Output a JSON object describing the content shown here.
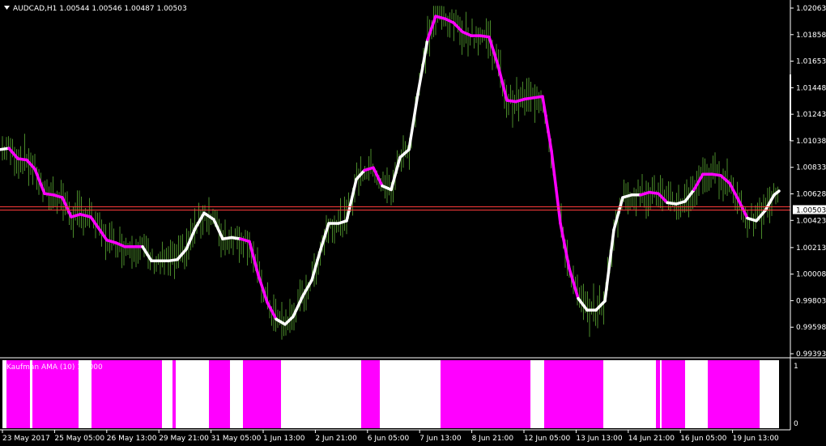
{
  "header": {
    "symbol_line": "AUDCAD,H1  1.00544 1.00546 1.00487 1.00503",
    "menu_arrow_icon": "triangle-down-icon"
  },
  "colors": {
    "background": "#000000",
    "candles": "#4a8a2a",
    "ama_up": "#ffffff",
    "ama_down": "#ff00ff",
    "price_line": "#ff3b3b",
    "price_label_bg": "#ffffff",
    "price_label_text": "#000000",
    "subwindow_bg": "#ffffff",
    "signal_fill": "#ff00ff",
    "axis": "#ffffff"
  },
  "price_axis": {
    "ticks": [
      "1.02063",
      "1.01858",
      "1.01653",
      "1.01448",
      "1.01243",
      "1.01038",
      "1.00833",
      "1.00628",
      "1.00423",
      "1.00213",
      "1.00008",
      "0.99803",
      "0.99598",
      "0.99393"
    ],
    "current_price": "1.00503"
  },
  "time_axis": {
    "labels": [
      "23 May 2017",
      "25 May 05:00",
      "26 May 13:00",
      "29 May 21:00",
      "31 May 05:00",
      "1 Jun 13:00",
      "2 Jun 21:00",
      "6 Jun 05:00",
      "7 Jun 13:00",
      "8 Jun 21:00",
      "12 Jun 05:00",
      "13 Jun 13:00",
      "14 Jun 21:00",
      "16 Jun 05:00",
      "19 Jun 13:00"
    ]
  },
  "indicator": {
    "label": "Kaufman AMA (10) 1.0000",
    "scale_top": "1",
    "scale_bottom": "0"
  },
  "chart_data": {
    "type": "line",
    "title": "AUDCAD,H1",
    "series": [
      {
        "name": "Kaufman AMA (10)",
        "x": [
          0,
          11,
          22,
          33,
          43,
          55,
          66,
          77,
          88,
          99,
          112,
          132,
          143,
          154,
          165,
          176,
          187,
          198,
          208,
          219,
          230,
          241,
          252,
          264,
          275,
          286,
          297,
          308,
          319,
          330,
          341,
          352,
          362,
          374,
          385,
          396,
          406,
          418,
          428,
          440,
          450,
          461,
          472,
          483,
          494,
          505,
          516,
          528,
          538,
          550,
          560,
          571,
          582,
          593,
          604,
          615,
          626,
          637,
          648,
          659,
          670,
          681,
          692,
          703,
          714,
          725,
          736,
          747,
          758,
          769,
          780,
          791,
          802,
          813,
          824,
          835,
          846,
          857,
          868,
          879,
          890,
          901,
          912,
          923,
          934,
          945,
          956,
          962
        ],
        "y": [
          1.0097,
          1.0098,
          1.009,
          1.0089,
          1.0082,
          1.0063,
          1.0062,
          1.006,
          1.0045,
          1.0047,
          1.0045,
          1.0027,
          1.0025,
          1.0022,
          1.0022,
          1.0022,
          1.0011,
          1.0011,
          1.0011,
          1.0012,
          1.002,
          1.0036,
          1.0048,
          1.0043,
          1.0028,
          1.0029,
          1.0028,
          1.0026,
          1.0,
          0.9979,
          0.9966,
          0.9962,
          0.9968,
          0.9984,
          0.9996,
          1.002,
          1.004,
          1.004,
          1.0042,
          1.0074,
          1.0081,
          1.0083,
          1.0069,
          1.0066,
          1.0091,
          1.0097,
          1.014,
          1.0182,
          1.02,
          1.0198,
          1.0195,
          1.0188,
          1.0185,
          1.0185,
          1.0184,
          1.0162,
          1.0135,
          1.0134,
          1.0136,
          1.0137,
          1.0138,
          1.0096,
          1.004,
          1.0005,
          0.9982,
          0.9973,
          0.9973,
          0.998,
          1.0035,
          1.006,
          1.0062,
          1.0062,
          1.0064,
          1.0063,
          1.0056,
          1.0055,
          1.0057,
          1.0066,
          1.0078,
          1.0078,
          1.0077,
          1.0071,
          1.0058,
          1.0044,
          1.0042,
          1.005,
          1.0062,
          1.0065
        ],
        "direction": [
          1,
          1,
          0,
          0,
          0,
          0,
          0,
          0,
          0,
          0,
          0,
          0,
          0,
          0,
          0,
          0,
          1,
          1,
          1,
          1,
          1,
          1,
          1,
          1,
          1,
          1,
          1,
          0,
          0,
          0,
          0,
          1,
          1,
          1,
          1,
          1,
          1,
          1,
          1,
          1,
          1,
          0,
          0,
          1,
          1,
          1,
          1,
          1,
          0,
          0,
          0,
          0,
          0,
          0,
          0,
          0,
          0,
          0,
          0,
          0,
          0,
          0,
          0,
          0,
          0,
          1,
          1,
          1,
          1,
          1,
          1,
          1,
          0,
          0,
          0,
          1,
          1,
          1,
          0,
          0,
          0,
          0,
          0,
          0,
          1,
          1,
          1,
          1
        ]
      }
    ],
    "candles_range": {
      "low": 0.9946,
      "high": 1.0208
    },
    "ylim": [
      0.99393,
      1.02063
    ],
    "signal_segments": [
      [
        8,
        37
      ],
      [
        40,
        97
      ],
      [
        113,
        200
      ],
      [
        213,
        217
      ],
      [
        258,
        284
      ],
      [
        300,
        347
      ],
      [
        446,
        469
      ],
      [
        544,
        655
      ],
      [
        672,
        745
      ],
      [
        810,
        815
      ],
      [
        817,
        846
      ],
      [
        874,
        938
      ]
    ],
    "signal_xlim": [
      0,
      962
    ],
    "grid": false
  }
}
